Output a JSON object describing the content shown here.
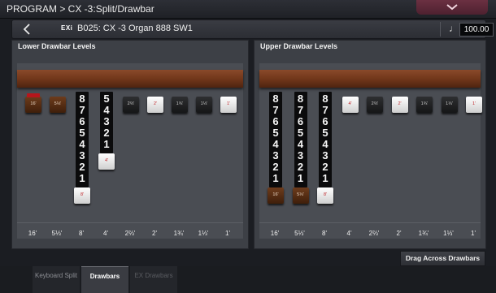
{
  "topbar": {
    "title": "PROGRAM > CX -3:Split/Drawbar"
  },
  "program": {
    "exi": "EXi",
    "name": "B025: CX -3 Organ 888 SW1",
    "tempo": "100.00",
    "tempo_icon": "♩"
  },
  "lower": {
    "title": "Lower Drawbar Levels",
    "drawbars": [
      {
        "feet": "16'",
        "footage_cap": "16'",
        "level": 0,
        "color": "brown"
      },
      {
        "feet": "5⅓'",
        "footage_cap": "5⅓'",
        "level": 0,
        "color": "brown"
      },
      {
        "feet": "8'",
        "footage_cap": "8'",
        "level": 8,
        "color": "white"
      },
      {
        "feet": "4'",
        "footage_cap": "4'",
        "level": 5,
        "color": "white"
      },
      {
        "feet": "2⅔'",
        "footage_cap": "2⅔'",
        "level": 0,
        "color": "black"
      },
      {
        "feet": "2'",
        "footage_cap": "2'",
        "level": 0,
        "color": "white"
      },
      {
        "feet": "1¾'",
        "footage_cap": "1¾'",
        "level": 0,
        "color": "black"
      },
      {
        "feet": "1⅓'",
        "footage_cap": "1⅓'",
        "level": 0,
        "color": "black"
      },
      {
        "feet": "1'",
        "footage_cap": "1'",
        "level": 0,
        "color": "white"
      }
    ]
  },
  "upper": {
    "title": "Upper Drawbar Levels",
    "drawbars": [
      {
        "feet": "16'",
        "footage_cap": "16'",
        "level": 8,
        "color": "brown"
      },
      {
        "feet": "5⅓'",
        "footage_cap": "5⅓'",
        "level": 8,
        "color": "brown"
      },
      {
        "feet": "8'",
        "footage_cap": "8'",
        "level": 8,
        "color": "white"
      },
      {
        "feet": "4'",
        "footage_cap": "4'",
        "level": 0,
        "color": "white"
      },
      {
        "feet": "2⅔'",
        "footage_cap": "2⅔'",
        "level": 0,
        "color": "black"
      },
      {
        "feet": "2'",
        "footage_cap": "2'",
        "level": 0,
        "color": "white"
      },
      {
        "feet": "1¾'",
        "footage_cap": "1¾'",
        "level": 0,
        "color": "black"
      },
      {
        "feet": "1⅓'",
        "footage_cap": "1⅓'",
        "level": 0,
        "color": "black"
      },
      {
        "feet": "1'",
        "footage_cap": "1'",
        "level": 0,
        "color": "white"
      }
    ]
  },
  "drag_button": "Drag Across Drawbars",
  "tabs": [
    {
      "label": "Keyboard Split",
      "state": "inactive"
    },
    {
      "label": "Drawbars",
      "state": "active"
    },
    {
      "label": "EX Drawbars",
      "state": "disabled"
    }
  ],
  "colors": {
    "wood": "#6f3519",
    "active_tab": "#3a3c42",
    "menu": "#5a2637"
  },
  "icons": {
    "menu": "chevron-down-icon",
    "back": "chevron-left-icon",
    "tempo": "quarter-note-icon"
  }
}
